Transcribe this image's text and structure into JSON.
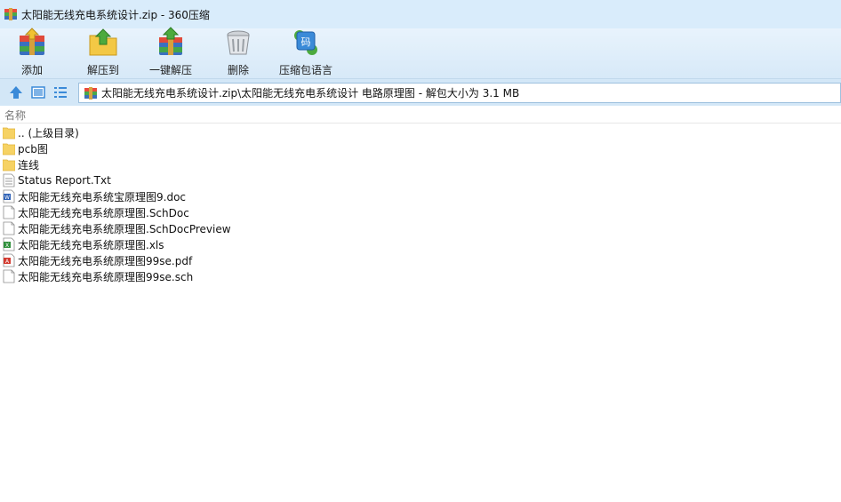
{
  "window": {
    "title": "太阳能无线充电系统设计.zip - 360压缩",
    "app_icon": "archive-icon"
  },
  "toolbar": {
    "buttons": [
      {
        "label": "添加",
        "icon": "add-archive-icon"
      },
      {
        "label": "解压到",
        "icon": "extract-to-icon"
      },
      {
        "label": "一键解压",
        "icon": "one-click-extract-icon"
      },
      {
        "label": "删除",
        "icon": "delete-icon"
      },
      {
        "label": "压缩包语言",
        "icon": "archive-language-icon"
      }
    ]
  },
  "addressbar": {
    "path": "太阳能无线充电系统设计.zip\\太阳能无线充电系统设计 电路原理图 - 解包大小为 3.1 MB"
  },
  "list": {
    "column_name": "名称",
    "items": [
      {
        "name": ".. (上级目录)",
        "type": "folder"
      },
      {
        "name": "pcb图",
        "type": "folder"
      },
      {
        "name": "连线",
        "type": "folder"
      },
      {
        "name": "Status Report.Txt",
        "type": "txt"
      },
      {
        "name": "太阳能无线充电系统宝原理图9.doc",
        "type": "doc"
      },
      {
        "name": "太阳能无线充电系统原理图.SchDoc",
        "type": "file"
      },
      {
        "name": "太阳能无线充电系统原理图.SchDocPreview",
        "type": "file"
      },
      {
        "name": "太阳能无线充电系统原理图.xls",
        "type": "xls"
      },
      {
        "name": "太阳能无线充电系统原理图99se.pdf",
        "type": "pdf"
      },
      {
        "name": "太阳能无线充电系统原理图99se.sch",
        "type": "file"
      }
    ]
  },
  "colors": {
    "titlebar_bg": "#d9ecfb",
    "toolbar_bg": "#dcecf9",
    "folder": "#f6d264",
    "accent_blue": "#3a8ad8"
  }
}
